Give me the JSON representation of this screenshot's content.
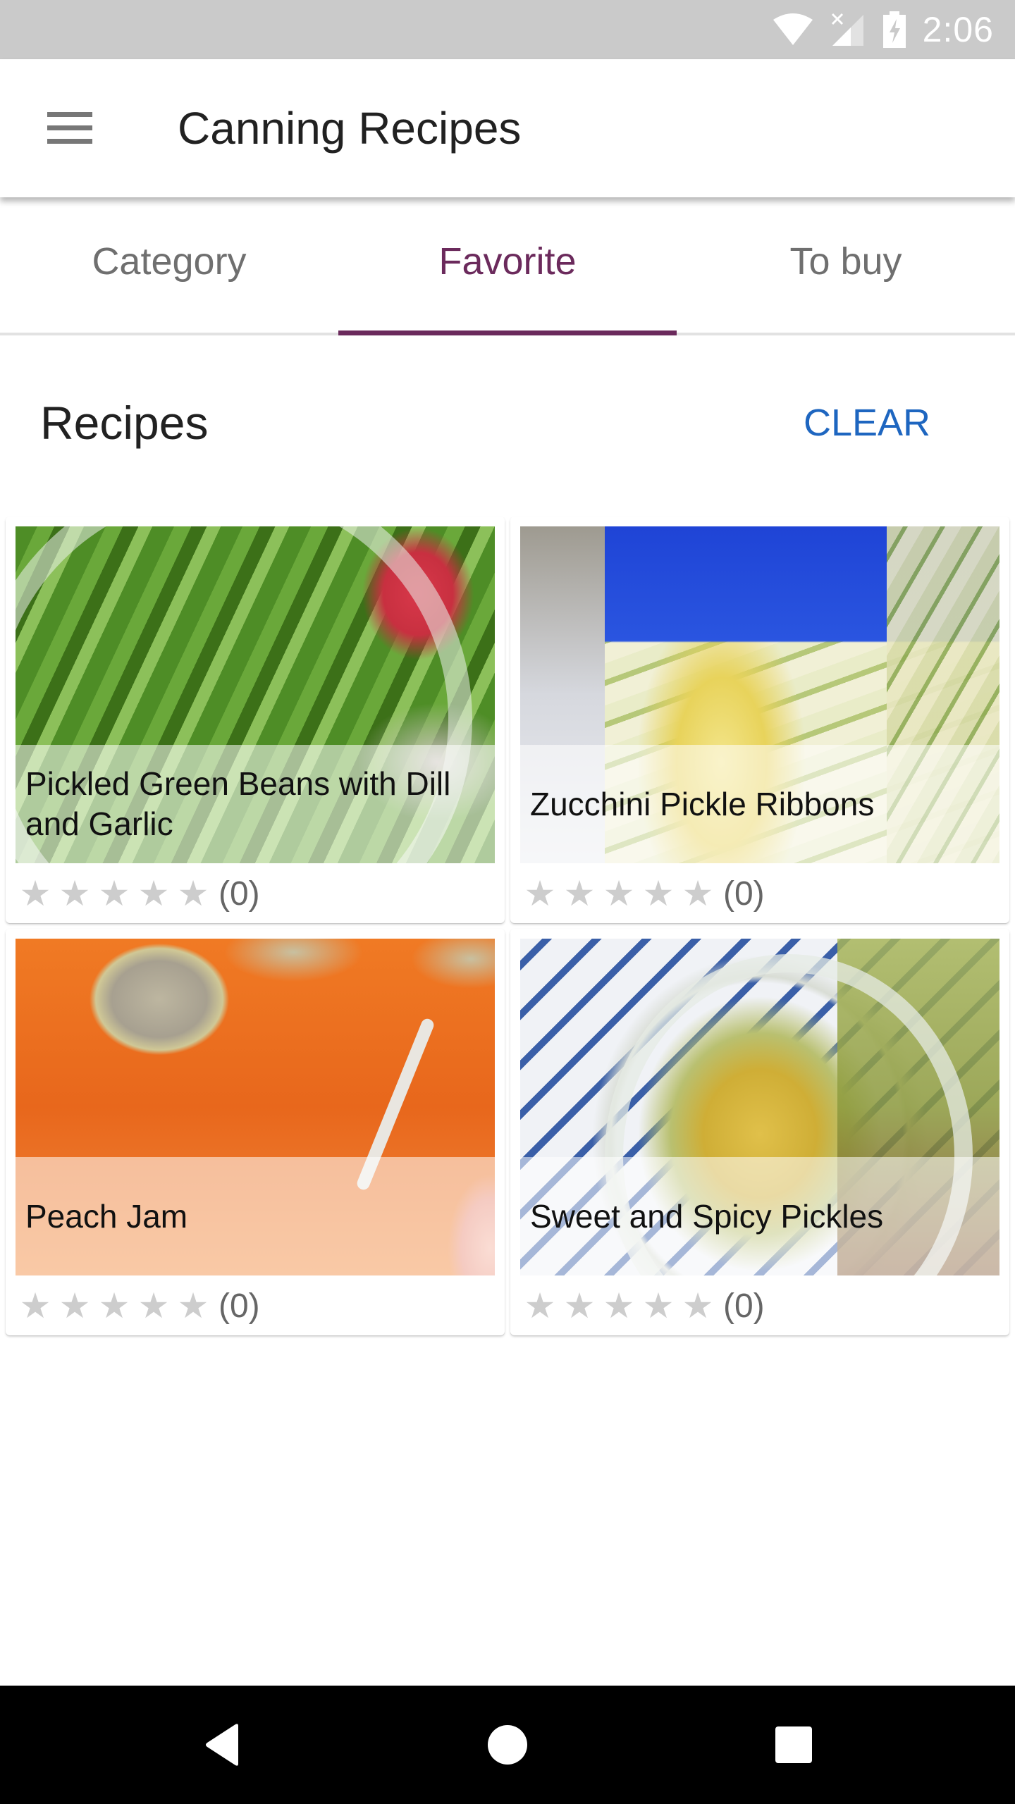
{
  "status_bar": {
    "time": "2:06",
    "icons": [
      "wifi-icon",
      "signal-no-data-icon",
      "battery-charging-icon"
    ]
  },
  "app_bar": {
    "menu_icon": "hamburger-menu-icon",
    "title": "Canning Recipes"
  },
  "tabs": [
    {
      "label": "Category",
      "active": false
    },
    {
      "label": "Favorite",
      "active": true
    },
    {
      "label": "To buy",
      "active": false
    }
  ],
  "section": {
    "title": "Recipes",
    "clear_label": "CLEAR"
  },
  "recipes": [
    {
      "title": "Pickled Green Beans with Dill and Garlic",
      "rating": 0,
      "max_rating": 5,
      "rating_count": "(0)",
      "image": "green beans in jar"
    },
    {
      "title": "Zucchini Pickle Ribbons",
      "rating": 0,
      "max_rating": 5,
      "rating_count": "(0)",
      "image": "zucchini ribbons in jar with blue lid"
    },
    {
      "title": "Peach Jam",
      "rating": 0,
      "max_rating": 5,
      "rating_count": "(0)",
      "image": "jars of peach jam"
    },
    {
      "title": "Sweet and Spicy Pickles",
      "rating": 0,
      "max_rating": 5,
      "rating_count": "(0)",
      "image": "cucumber pickles in jar"
    }
  ],
  "star_glyph": "★",
  "nav_bar": {
    "buttons": [
      "back-icon",
      "home-icon",
      "recents-icon"
    ]
  },
  "colors": {
    "accent": "#6b2a5c",
    "clear_button": "#1e66c0",
    "status_bar": "#cacaca",
    "star_empty": "#cdcdcd",
    "nav_bar": "#000000"
  }
}
